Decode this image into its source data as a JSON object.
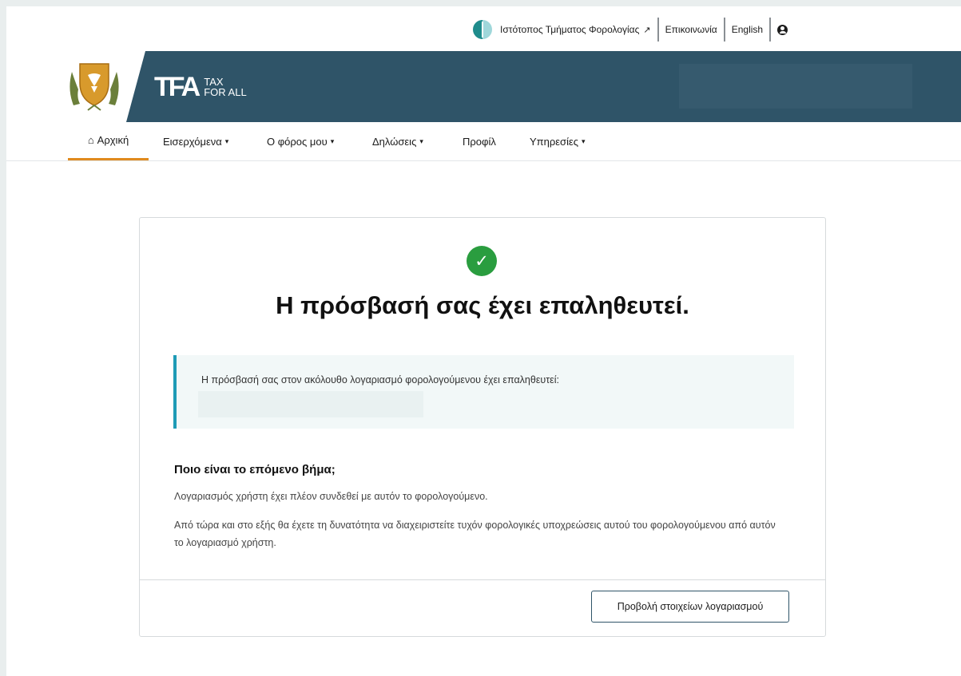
{
  "utility": {
    "site_link": "Ιστότοπος Τμήματος Φορολογίας",
    "external_arrow": "↗",
    "contact": "Επικοινωνία",
    "language": "English"
  },
  "brand": {
    "mark": "TFA",
    "line1": "TAX",
    "line2": "FOR ALL"
  },
  "nav": {
    "items": [
      {
        "label": "Αρχική",
        "icon": "home-icon",
        "active": true
      },
      {
        "label": "Εισερχόμενα",
        "dropdown": true
      },
      {
        "label": "Ο φόρος μου",
        "dropdown": true
      },
      {
        "label": "Δηλώσεις",
        "dropdown": true
      },
      {
        "label": "Προφίλ",
        "dropdown": false
      },
      {
        "label": "Υπηρεσίες",
        "dropdown": true
      }
    ],
    "caret": "▾",
    "home_glyph": "⌂"
  },
  "card": {
    "check_glyph": "✓",
    "title": "Η πρόσβασή σας έχει επαληθευτεί.",
    "info_text": "Η πρόσβασή σας στον ακόλουθο λογαριασμό φορολογούμενου έχει επαληθευτεί:",
    "next_heading": "Ποιο είναι το επόμενο βήμα;",
    "paragraph1": "Λογαριασμός χρήστη έχει πλέον συνδεθεί με αυτόν το φορολογούμενο.",
    "paragraph2": "Από τώρα και στο εξής θα έχετε τη δυνατότητα να διαχειριστείτε τυχόν φορολογικές υποχρεώσεις αυτού του φορολογούμενου από αυτόν το λογαριασμό χρήστη.",
    "button": "Προβολή στοιχείων λογαριασμού"
  },
  "colors": {
    "header": "#2f5468",
    "accent": "#e08a1e",
    "success": "#2a9d3f",
    "info_border": "#1e9bb6"
  }
}
